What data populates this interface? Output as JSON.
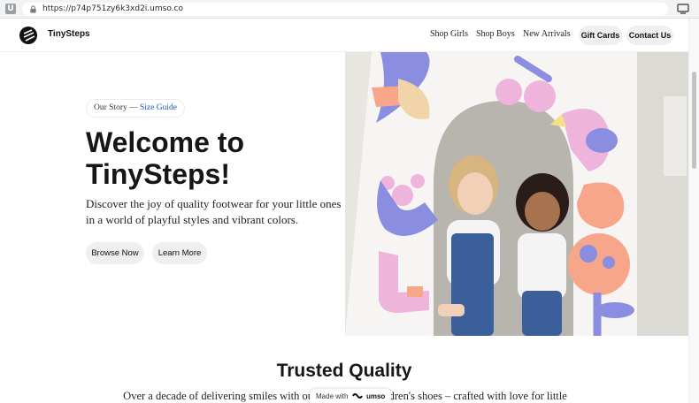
{
  "browser": {
    "tab_icon_letter": "U",
    "url": "https://p74p751zy6k3xd2i.umso.co"
  },
  "header": {
    "brand": "TinySteps",
    "nav": [
      "Shop Girls",
      "Shop Boys",
      "New Arrivals"
    ],
    "gift_cards": "Gift Cards",
    "contact": "Contact Us"
  },
  "hero": {
    "story_label": "Our Story",
    "story_separator": "—",
    "size_guide": "Size Guide",
    "title": "Welcome to TinySteps!",
    "subtitle": "Discover the joy of quality footwear for your little ones in a world of playful styles and vibrant colors.",
    "browse_button": "Browse Now",
    "learn_button": "Learn More"
  },
  "trusted": {
    "title": "Trusted Quality",
    "text": "Over a decade of delivering smiles with our cozy, c          ndy children's shoes – crafted with love for little"
  },
  "badge": {
    "made_with": "Made with",
    "brand": "umso"
  },
  "colors": {
    "accent_link": "#1e57b4",
    "pill_bg": "#f0f0f0",
    "lavender": "#8b8ee0",
    "peach": "#f7a68a",
    "pink": "#eeb4dc"
  }
}
